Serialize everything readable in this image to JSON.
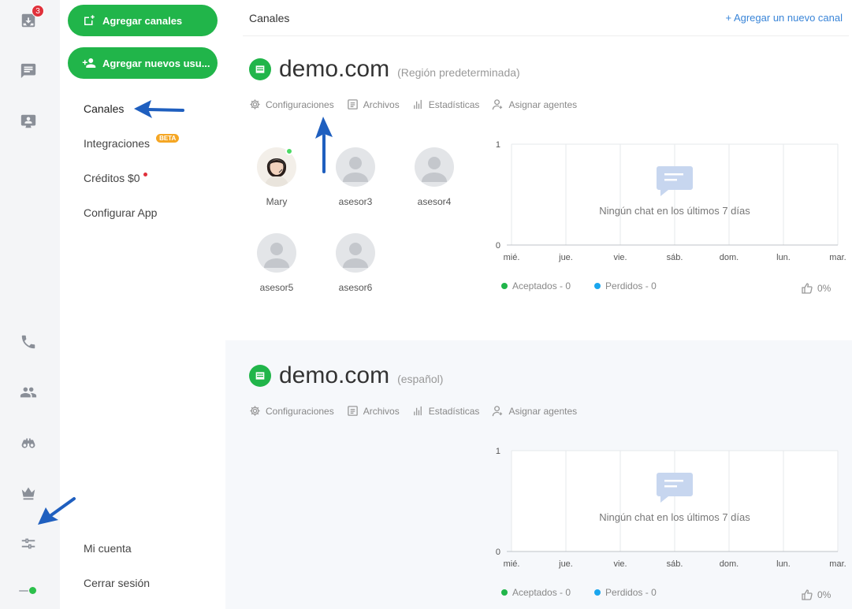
{
  "rail": {
    "inbox_badge": "3"
  },
  "sidebar": {
    "add_channels": "Agregar canales",
    "add_users": "Agregar nuevos usu...",
    "items": [
      {
        "label": "Canales"
      },
      {
        "label": "Integraciones",
        "badge": "BETA"
      },
      {
        "label": "Créditos $0"
      },
      {
        "label": "Configurar App"
      }
    ],
    "bottom": [
      {
        "label": "Mi cuenta"
      },
      {
        "label": "Cerrar sesión"
      }
    ]
  },
  "header": {
    "title": "Canales",
    "add_link": "+ Agregar un nuevo canal"
  },
  "tabs": [
    "Configuraciones",
    "Archivos",
    "Estadísticas",
    "Asignar agentes"
  ],
  "channels": [
    {
      "name": "demo.com",
      "region": "(Región predeterminada)",
      "agents": [
        "Mary",
        "asesor3",
        "asesor4",
        "asesor5",
        "asesor6"
      ],
      "empty_text": "Ningún chat en los últimos 7 días",
      "legend": {
        "accepted": "Aceptados - 0",
        "lost": "Perdidos - 0"
      },
      "rating": "0%"
    },
    {
      "name": "demo.com",
      "region": "(español)",
      "agents": [],
      "empty_text": "Ningún chat en los últimos 7 días",
      "legend": {
        "accepted": "Aceptados - 0",
        "lost": "Perdidos - 0"
      },
      "rating": "0%"
    }
  ],
  "chart_data": [
    {
      "type": "line",
      "categories": [
        "mié.",
        "jue.",
        "vie.",
        "sáb.",
        "dom.",
        "lun.",
        "mar."
      ],
      "ylim": [
        0,
        1
      ],
      "yticks": [
        "0",
        "1"
      ],
      "series": [
        {
          "name": "Aceptados - 0",
          "values": [
            0,
            0,
            0,
            0,
            0,
            0,
            0
          ],
          "color": "#21b54a"
        },
        {
          "name": "Perdidos - 0",
          "values": [
            0,
            0,
            0,
            0,
            0,
            0,
            0
          ],
          "color": "#1aa6ee"
        }
      ]
    },
    {
      "type": "line",
      "categories": [
        "mié.",
        "jue.",
        "vie.",
        "sáb.",
        "dom.",
        "lun.",
        "mar."
      ],
      "ylim": [
        0,
        1
      ],
      "yticks": [
        "0",
        "1"
      ],
      "series": [
        {
          "name": "Aceptados - 0",
          "values": [
            0,
            0,
            0,
            0,
            0,
            0,
            0
          ],
          "color": "#21b54a"
        },
        {
          "name": "Perdidos - 0",
          "values": [
            0,
            0,
            0,
            0,
            0,
            0,
            0
          ],
          "color": "#1aa6ee"
        }
      ]
    }
  ],
  "colors": {
    "brand_green": "#21b54a",
    "link_blue": "#3a85d8",
    "lost_blue": "#1aa6ee",
    "badge_red": "#e0313b",
    "beta_orange": "#f5a623"
  }
}
